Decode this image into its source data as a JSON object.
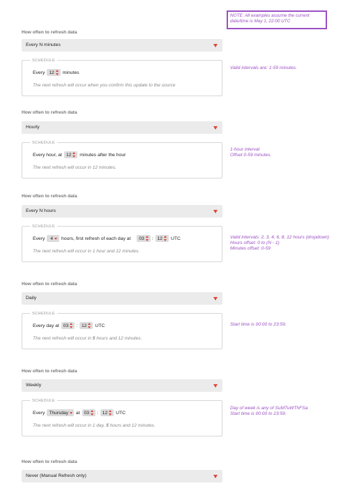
{
  "note": "NOTE: All examples assume the current date/time is May 1, 22:00 UTC",
  "freq_label": "How often to refresh data",
  "schedule_legend": "SCHEDULE",
  "sections": [
    {
      "selected": "Every N minutes",
      "schedule": {
        "prefix": "Every",
        "minutes": "12",
        "suffix": "minutes",
        "note": "The next refresh will occur when you confirm this update to the source"
      },
      "side_note": [
        "Valid intervals are: 1-59 minutes."
      ]
    },
    {
      "selected": "Hourly",
      "schedule": {
        "prefix": "Every hour, at",
        "minutes": "12",
        "suffix": "minutes after the hour",
        "note": "The next refresh will occur in 12 minutes."
      },
      "side_note": [
        "1-hour interval",
        "Offset 0-59 minutes."
      ]
    },
    {
      "selected": "Every N hours",
      "schedule": {
        "prefix": "Every",
        "hours": "4",
        "middle": "hours, first refresh of each day at",
        "hour": "03",
        "minute": "12",
        "tz": "UTC",
        "note": "The next refresh will occur in 1 hour and 12 minutes."
      },
      "side_note": [
        "Valid intervals: 2, 3, 4, 6, 8, 12 hours (dropdown)",
        "Hours offset: 0 to (N - 1)",
        "Minutes offset: 0-59"
      ]
    },
    {
      "selected": "Daily",
      "schedule": {
        "prefix": "Every day at",
        "hour": "03",
        "minute": "12",
        "tz": "UTC",
        "note_pre": "The next refresh will occur in ",
        "note_bold": "5",
        "note_post": " hours and 12 minutes."
      },
      "side_note": [
        "Start time is 00:00 to 23:59."
      ]
    },
    {
      "selected": "Weekly",
      "schedule": {
        "prefix": "Every",
        "day": "Thursday",
        "at": "at",
        "hour": "03",
        "minute": "12",
        "tz": "UTC",
        "note_pre": "The next refresh will occur in 1 day, ",
        "note_bold": "5",
        "note_post": " hours and 12 minutes."
      },
      "side_note": [
        "Day of week is any of SuMTuWThFSa",
        "Start time is 00:00 to 23:59."
      ]
    },
    {
      "selected": "Never (Manual Refresh only)"
    }
  ],
  "colors": {
    "annotation": "#9b4fc4",
    "caret": "#e0443a",
    "select_bg": "#ebebeb"
  }
}
